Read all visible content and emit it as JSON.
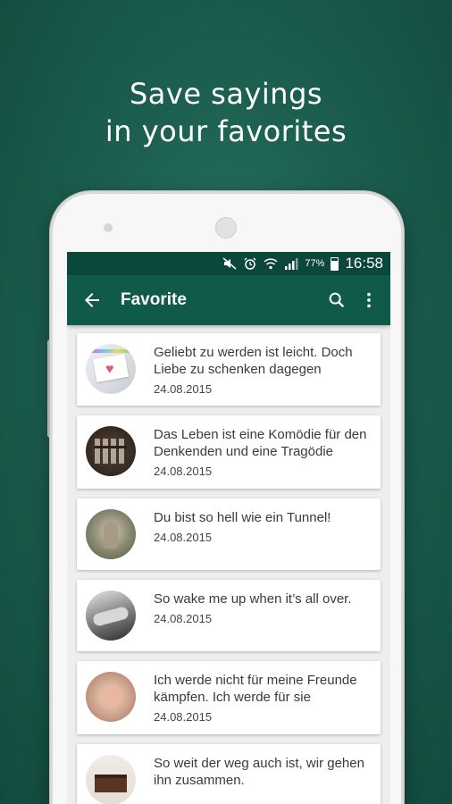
{
  "promo": {
    "line1": "Save sayings",
    "line2": "in your favorites"
  },
  "statusbar": {
    "battery_percent": "77%",
    "time": "16:58",
    "icons": [
      "mute-icon",
      "alarm-icon",
      "wifi-icon",
      "signal-icon",
      "battery-icon"
    ]
  },
  "appbar": {
    "title": "Favorite",
    "back_icon": "arrow-back-icon",
    "actions": [
      "search-icon",
      "more-vert-icon"
    ]
  },
  "favorites": [
    {
      "saying": "Geliebt zu werden ist leicht. Doch Liebe zu schenken dagegen",
      "date": "24.08.2015",
      "thumb": "heart-note-image"
    },
    {
      "saying": "Das Leben ist eine Komödie für den Denkenden und eine Tragödie",
      "date": "24.08.2015",
      "thumb": "letter-tiles-image"
    },
    {
      "saying": "Du bist so hell wie ein Tunnel!",
      "date": "24.08.2015",
      "thumb": "tunnel-figure-image"
    },
    {
      "saying": "So wake me up when it’s all over.",
      "date": "24.08.2015",
      "thumb": "sleeping-person-image"
    },
    {
      "saying": "Ich werde nicht für meine Freunde kämpfen. Ich werde für sie",
      "date": "24.08.2015",
      "thumb": "hands-image"
    },
    {
      "saying": "So weit der weg auch ist, wir gehen ihn zusammen.",
      "date": "",
      "thumb": "cake-image"
    }
  ],
  "colors": {
    "background": "#1c5f50",
    "statusbar": "#0c473b",
    "appbar": "#0f5a49",
    "card": "#ffffff"
  }
}
